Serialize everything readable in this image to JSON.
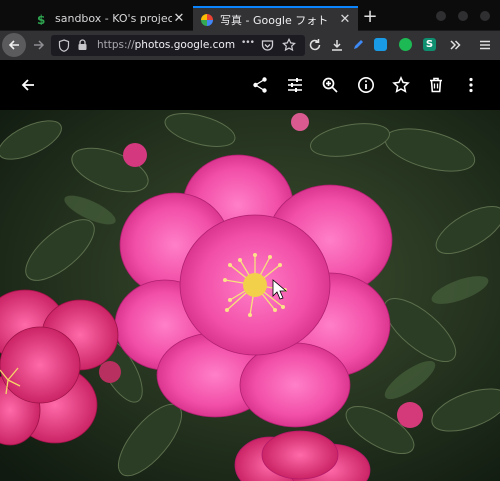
{
  "browser": {
    "tabs": [
      {
        "title": "sandbox - KO's project",
        "close_glyph": "✕"
      },
      {
        "title": "写真 - Google フォト",
        "close_glyph": "✕"
      }
    ],
    "new_tab_glyph": "+",
    "url_prefix": "https://",
    "url_host": "photos.google.com",
    "overflow_glyph": "•••",
    "menu_icon": "hamburger-icon"
  },
  "viewer": {
    "back_icon": "arrow-back-icon",
    "actions": [
      "share-icon",
      "edit-icon",
      "zoom-icon",
      "info-icon",
      "favorite-icon",
      "delete-icon",
      "more-icon"
    ]
  },
  "photo": {
    "subject": "pink-camellia-flower"
  },
  "colors": {
    "tab_accent": "#0a84ff",
    "toolbar": "#323234",
    "app_background": "#000000"
  }
}
